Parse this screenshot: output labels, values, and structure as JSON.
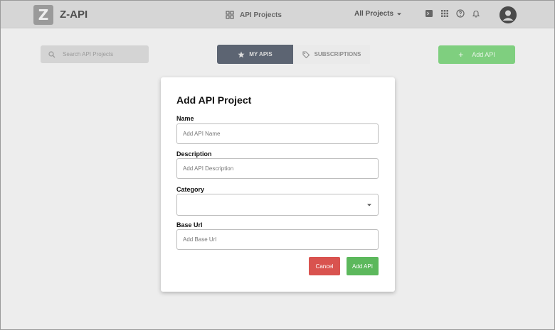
{
  "header": {
    "logo_mark": "Z",
    "app_name": "Z-API",
    "nav_projects": "API Projects",
    "project_filter": "All Projects"
  },
  "toolbar": {
    "search_placeholder": "Search API Projects",
    "tabs": [
      {
        "label": "MY APIS",
        "icon": "star-icon",
        "active": true
      },
      {
        "label": "SUBSCRIPTIONS",
        "icon": "tags-icon",
        "active": false
      }
    ],
    "add_button_label": "Add API"
  },
  "modal": {
    "title": "Add API Project",
    "fields": [
      {
        "label": "Name",
        "placeholder": "Add API Name"
      },
      {
        "label": "Description",
        "placeholder": "Add API Description"
      },
      {
        "label": "Category",
        "value": ""
      },
      {
        "label": "Base Url",
        "placeholder": "Add Base Url"
      }
    ],
    "cancel_label": "Cancel",
    "submit_label": "Add API"
  },
  "colors": {
    "active_tab": "#5c6472",
    "add_top": "#7fcf7f",
    "cancel": "#d9534f",
    "submit": "#5cb85c"
  }
}
